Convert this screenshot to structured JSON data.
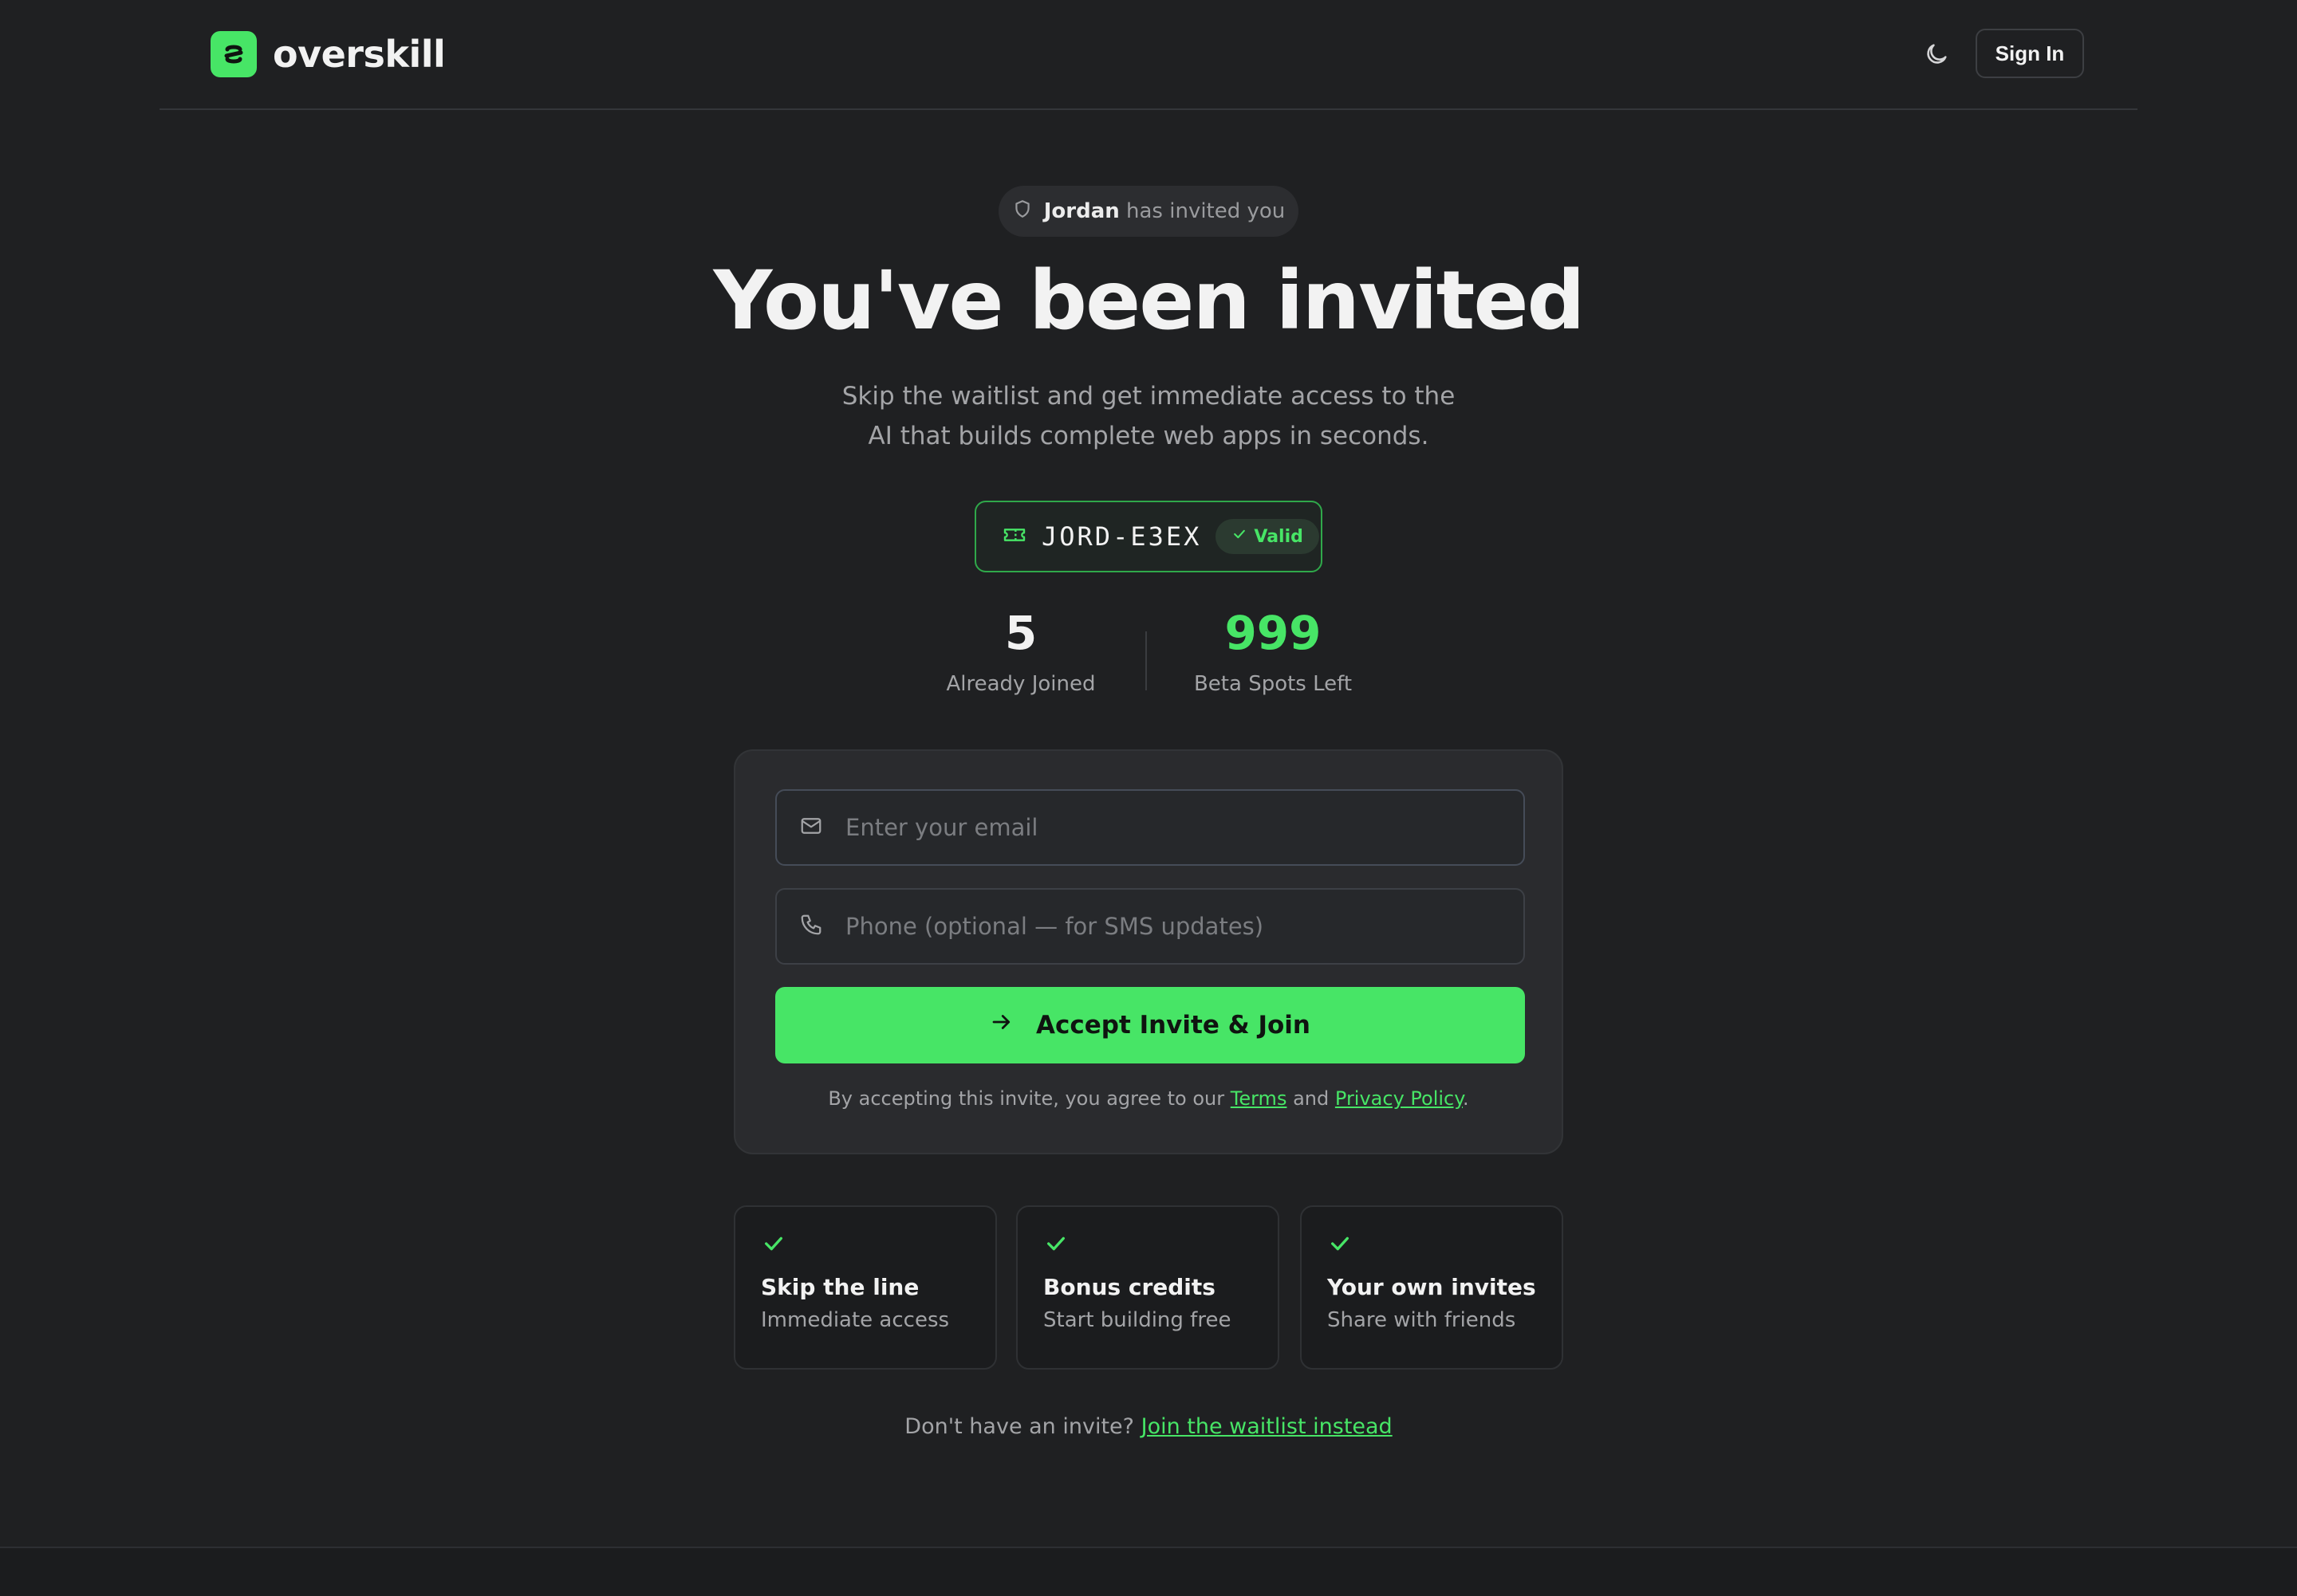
{
  "brand": {
    "name": "overskill",
    "accent": "#47e566"
  },
  "header": {
    "theme_toggle_icon": "moon-icon",
    "sign_in_label": "Sign In"
  },
  "invite": {
    "inviter": "Jordan",
    "suffix": "has invited you"
  },
  "hero": {
    "title": "You've been invited",
    "subtitle": "Skip the waitlist and get immediate access to the AI that builds complete web apps in seconds."
  },
  "code": {
    "value": "JORD-E3EX",
    "status": "Valid"
  },
  "stats": [
    {
      "value": "5",
      "label": "Already Joined"
    },
    {
      "value": "999",
      "label": "Beta Spots Left"
    }
  ],
  "form": {
    "email_placeholder": "Enter your email",
    "phone_placeholder": "Phone (optional — for SMS updates)",
    "submit_label": "Accept Invite & Join",
    "legal_prefix": "By accepting this invite, you agree to our",
    "terms_label": "Terms",
    "legal_and": "and",
    "privacy_label": "Privacy Policy",
    "legal_end": "."
  },
  "features": [
    {
      "title": "Skip the line",
      "desc": "Immediate access"
    },
    {
      "title": "Bonus credits",
      "desc": "Start building free"
    },
    {
      "title": "Your own invites",
      "desc": "Share with friends"
    }
  ],
  "bottom": {
    "text": "Don't have an invite?",
    "link": "Join the waitlist instead"
  }
}
